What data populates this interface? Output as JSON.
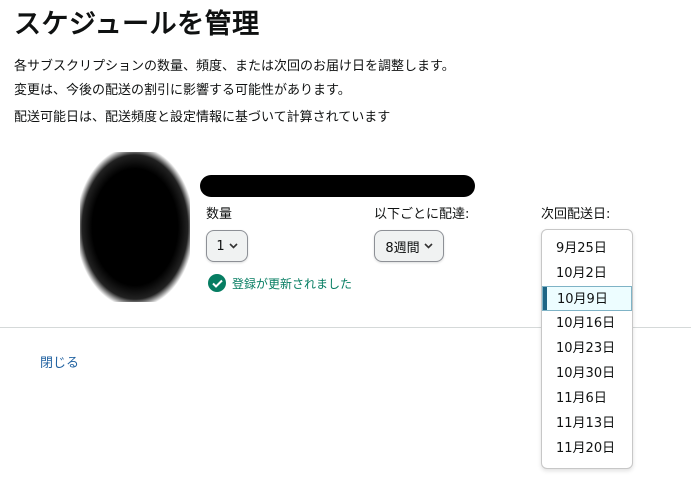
{
  "header": {
    "title": "スケジュールを管理"
  },
  "description": [
    "各サブスクリプションの数量、頻度、または次回のお届け日を調整します。",
    "変更は、今後の配送の割引に影響する可能性があります。",
    "配送可能日は、配送頻度と設定情報に基づいて計算されています"
  ],
  "item": {
    "quantity_label": "数量",
    "quantity_value": "1",
    "frequency_label": "以下ごとに配達:",
    "frequency_value": "8週間",
    "next_delivery_label": "次回配送日:",
    "status_text": "登録が更新されました"
  },
  "delivery_dates": {
    "options": [
      "9月25日",
      "10月2日",
      "10月9日",
      "10月16日",
      "10月23日",
      "10月30日",
      "11月6日",
      "11月13日",
      "11月20日"
    ],
    "selected": "10月9日"
  },
  "footer": {
    "close_label": "閉じる"
  },
  "colors": {
    "success": "#067d62",
    "link": "#2162a1",
    "selected_accent": "#1f6685"
  }
}
